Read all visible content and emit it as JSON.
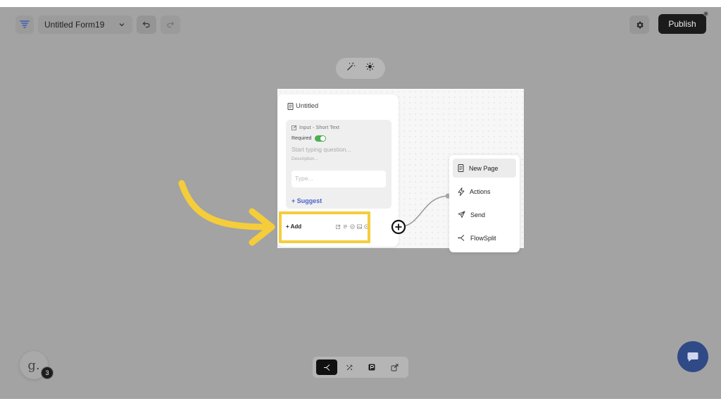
{
  "toolbar": {
    "logo_icon": "funnel-logo-icon",
    "form_name": "Untitled Form19",
    "publish_label": "Publish"
  },
  "page": {
    "title": "Untitled",
    "input": {
      "type_label": "Input - Short Text",
      "required_label": "Required",
      "required_on": true,
      "question_placeholder": "Start typing question...",
      "description_placeholder": "Description...",
      "answer_placeholder": "Type..."
    },
    "suggest_label": "+ Suggest",
    "add_label": "+ Add"
  },
  "menu": {
    "items": [
      {
        "label": "New Page",
        "icon": "document-icon",
        "active": true
      },
      {
        "label": "Actions",
        "icon": "lightning-icon",
        "active": false
      },
      {
        "label": "Send",
        "icon": "send-icon",
        "active": false
      },
      {
        "label": "FlowSplit",
        "icon": "flowsplit-icon",
        "active": false
      }
    ]
  },
  "avatar": {
    "letter": "g.",
    "badge_count": "3"
  },
  "colors": {
    "accent": "#4a63c8",
    "highlight": "#f5cd3a",
    "toggle_on": "#4caf50",
    "chat_button": "#2f4a86"
  }
}
